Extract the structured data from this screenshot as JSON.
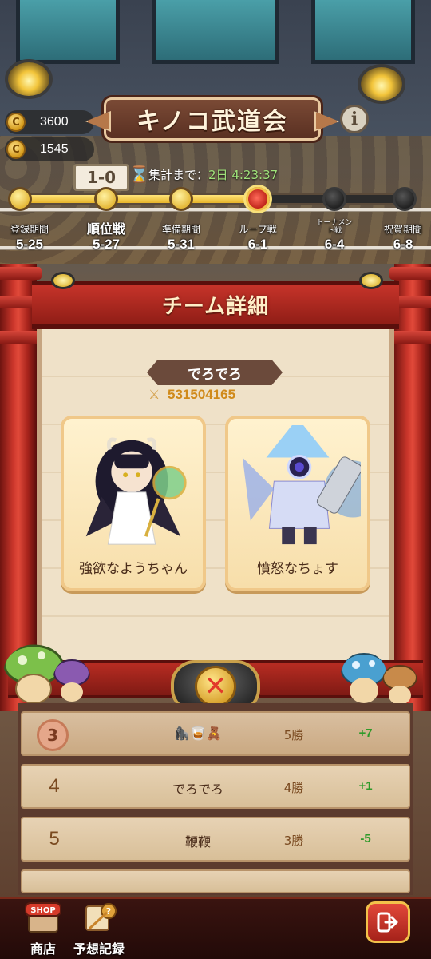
{
  "header": {
    "currency": [
      {
        "icon": "mushroom-coin-icon",
        "value": "3600"
      },
      {
        "icon": "mushroom-ticket-icon",
        "value": "1545"
      }
    ],
    "title": "キノコ武道会",
    "info_icon": "info-icon",
    "scoreboard": "1-0",
    "countdown_label": "集計まで：",
    "countdown_value": "2日 4:23:37"
  },
  "phases": [
    {
      "label": "登録期間",
      "date": "5-25",
      "state": "done"
    },
    {
      "label": "順位戦",
      "date": "5-27",
      "state": "done"
    },
    {
      "label": "準備期間",
      "date": "5-31",
      "state": "done"
    },
    {
      "label": "ループ戦",
      "date": "6-1",
      "state": "current"
    },
    {
      "label": "トーナメント戦",
      "date": "6-4",
      "state": "future"
    },
    {
      "label": "祝賀期間",
      "date": "6-8",
      "state": "future"
    }
  ],
  "progress": 0.6,
  "panel": {
    "title": "チーム詳細",
    "team_name": "でろでろ",
    "power": "531504165",
    "members": [
      {
        "name": "強欲なようちゃん"
      },
      {
        "name": "憤怒なちょす"
      }
    ],
    "close_icon": "close-x-icon"
  },
  "rankings": [
    {
      "rank": "3",
      "name": "🦍🥃🧸",
      "wins": "5勝",
      "delta": "+7"
    },
    {
      "rank": "4",
      "name": "でろでろ",
      "wins": "4勝",
      "delta": "+1"
    },
    {
      "rank": "5",
      "name": "鞭鞭",
      "wins": "3勝",
      "delta": "-5"
    }
  ],
  "bottom_nav": {
    "shop_label": "商店",
    "shop_badge": "SHOP",
    "prediction_label": "予想記録",
    "exit_icon": "exit-icon"
  },
  "colors": {
    "accent_red": "#c9352a",
    "gold": "#e7b52a",
    "panel_bg": "#efe1c8",
    "positive": "#2f9a2a"
  }
}
